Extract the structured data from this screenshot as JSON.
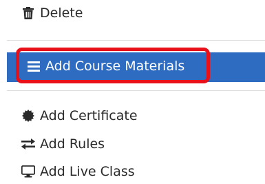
{
  "menu": {
    "items": [
      {
        "label": "Delete",
        "icon": "trash-icon"
      },
      {
        "label": "Add Course Materials",
        "icon": "bars-icon",
        "active": true
      },
      {
        "label": "Add Certificate",
        "icon": "certificate-icon"
      },
      {
        "label": "Add Rules",
        "icon": "exchange-icon"
      },
      {
        "label": "Add Live Class",
        "icon": "desktop-icon"
      }
    ]
  },
  "colors": {
    "active_background": "#2e6cc2",
    "highlight_border": "#e8111a",
    "text": "#2a2a2a"
  }
}
